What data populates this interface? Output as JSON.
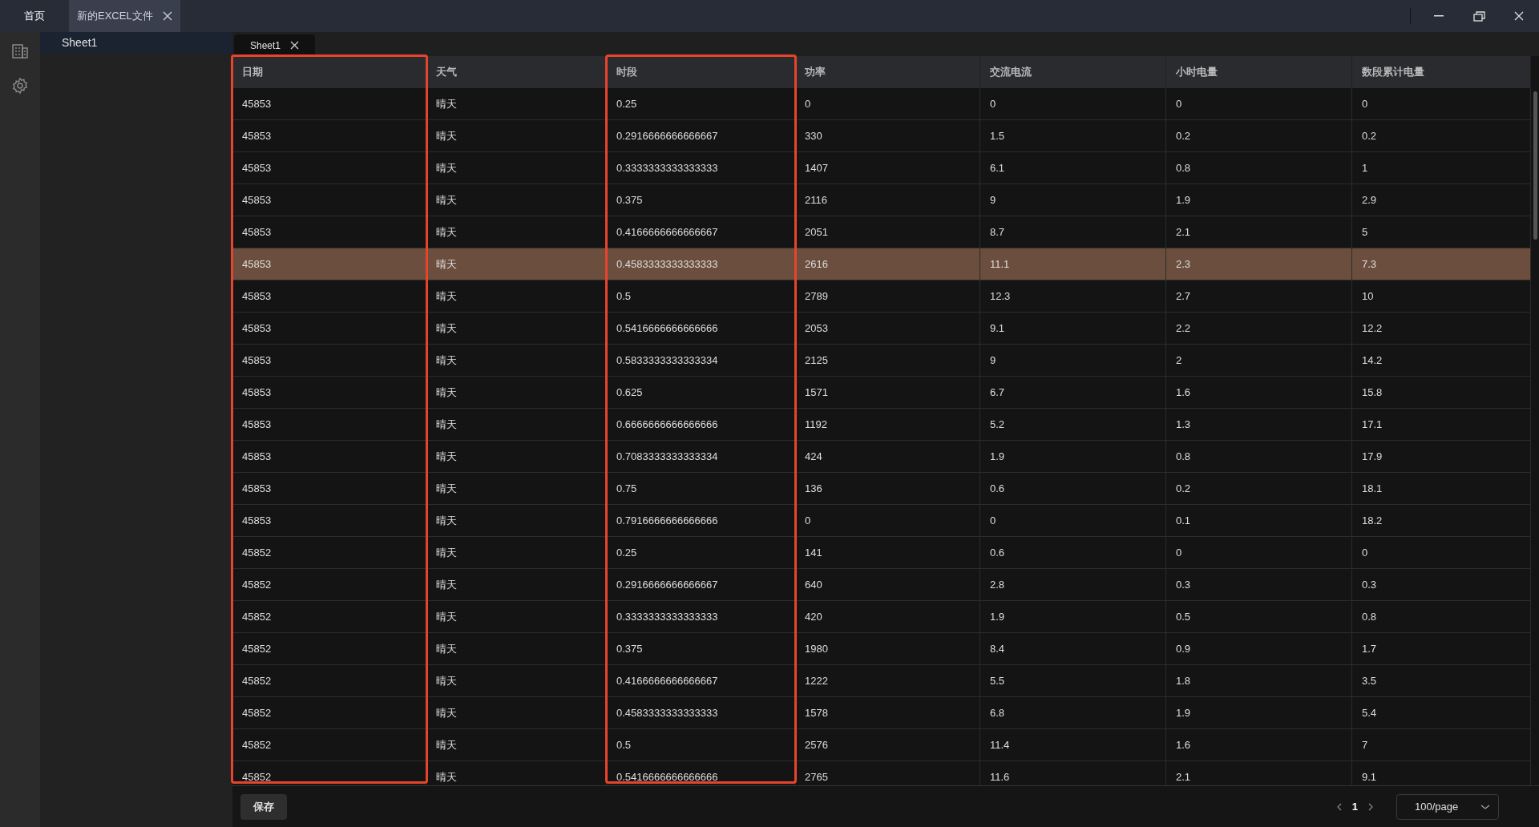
{
  "app_tabs": [
    {
      "label": "首页",
      "selected": false,
      "closable": false
    },
    {
      "label": "新的EXCEL文件",
      "selected": true,
      "closable": true
    }
  ],
  "sidebar": {
    "items": [
      {
        "label": "Sheet1",
        "selected": true
      }
    ]
  },
  "sheet_tabs": [
    {
      "label": "Sheet1",
      "selected": true
    }
  ],
  "table": {
    "columns": [
      {
        "label": "日期",
        "highlighted": true
      },
      {
        "label": "天气",
        "highlighted": false
      },
      {
        "label": "时段",
        "highlighted": true
      },
      {
        "label": "功率",
        "highlighted": false
      },
      {
        "label": "交流电流",
        "highlighted": false
      },
      {
        "label": "小时电量",
        "highlighted": false
      },
      {
        "label": "数段累计电量",
        "highlighted": false
      }
    ],
    "rows": [
      {
        "selected": false,
        "cells": [
          "45853",
          "晴天",
          "0.25",
          "0",
          "0",
          "0",
          "0"
        ]
      },
      {
        "selected": false,
        "cells": [
          "45853",
          "晴天",
          "0.2916666666666667",
          "330",
          "1.5",
          "0.2",
          "0.2"
        ]
      },
      {
        "selected": false,
        "cells": [
          "45853",
          "晴天",
          "0.3333333333333333",
          "1407",
          "6.1",
          "0.8",
          "1"
        ]
      },
      {
        "selected": false,
        "cells": [
          "45853",
          "晴天",
          "0.375",
          "2116",
          "9",
          "1.9",
          "2.9"
        ]
      },
      {
        "selected": false,
        "cells": [
          "45853",
          "晴天",
          "0.4166666666666667",
          "2051",
          "8.7",
          "2.1",
          "5"
        ]
      },
      {
        "selected": true,
        "cells": [
          "45853",
          "晴天",
          "0.4583333333333333",
          "2616",
          "11.1",
          "2.3",
          "7.3"
        ]
      },
      {
        "selected": false,
        "cells": [
          "45853",
          "晴天",
          "0.5",
          "2789",
          "12.3",
          "2.7",
          "10"
        ]
      },
      {
        "selected": false,
        "cells": [
          "45853",
          "晴天",
          "0.5416666666666666",
          "2053",
          "9.1",
          "2.2",
          "12.2"
        ]
      },
      {
        "selected": false,
        "cells": [
          "45853",
          "晴天",
          "0.5833333333333334",
          "2125",
          "9",
          "2",
          "14.2"
        ]
      },
      {
        "selected": false,
        "cells": [
          "45853",
          "晴天",
          "0.625",
          "1571",
          "6.7",
          "1.6",
          "15.8"
        ]
      },
      {
        "selected": false,
        "cells": [
          "45853",
          "晴天",
          "0.6666666666666666",
          "1192",
          "5.2",
          "1.3",
          "17.1"
        ]
      },
      {
        "selected": false,
        "cells": [
          "45853",
          "晴天",
          "0.7083333333333334",
          "424",
          "1.9",
          "0.8",
          "17.9"
        ]
      },
      {
        "selected": false,
        "cells": [
          "45853",
          "晴天",
          "0.75",
          "136",
          "0.6",
          "0.2",
          "18.1"
        ]
      },
      {
        "selected": false,
        "cells": [
          "45853",
          "晴天",
          "0.7916666666666666",
          "0",
          "0",
          "0.1",
          "18.2"
        ]
      },
      {
        "selected": false,
        "cells": [
          "45852",
          "晴天",
          "0.25",
          "141",
          "0.6",
          "0",
          "0"
        ]
      },
      {
        "selected": false,
        "cells": [
          "45852",
          "晴天",
          "0.2916666666666667",
          "640",
          "2.8",
          "0.3",
          "0.3"
        ]
      },
      {
        "selected": false,
        "cells": [
          "45852",
          "晴天",
          "0.3333333333333333",
          "420",
          "1.9",
          "0.5",
          "0.8"
        ]
      },
      {
        "selected": false,
        "cells": [
          "45852",
          "晴天",
          "0.375",
          "1980",
          "8.4",
          "0.9",
          "1.7"
        ]
      },
      {
        "selected": false,
        "cells": [
          "45852",
          "晴天",
          "0.4166666666666667",
          "1222",
          "5.5",
          "1.8",
          "3.5"
        ]
      },
      {
        "selected": false,
        "cells": [
          "45852",
          "晴天",
          "0.4583333333333333",
          "1578",
          "6.8",
          "1.9",
          "5.4"
        ]
      },
      {
        "selected": false,
        "cells": [
          "45852",
          "晴天",
          "0.5",
          "2576",
          "11.4",
          "1.6",
          "7"
        ]
      },
      {
        "selected": false,
        "cells": [
          "45852",
          "晴天",
          "0.5416666666666666",
          "2765",
          "11.6",
          "2.1",
          "9.1"
        ]
      }
    ]
  },
  "footer": {
    "save_button": "保存",
    "pagination": {
      "pages": [
        {
          "label": "1",
          "selected": true
        }
      ],
      "page_size": "100/page"
    }
  }
}
